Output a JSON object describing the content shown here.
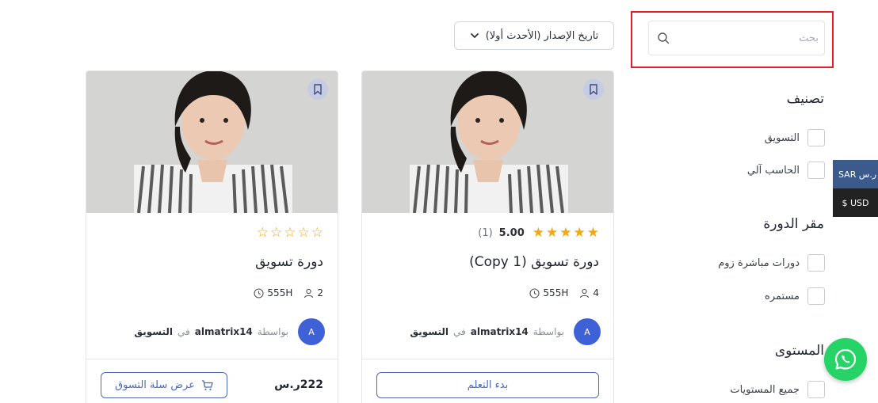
{
  "search": {
    "placeholder": "بحث"
  },
  "sort": {
    "selected": "تاريخ الإصدار (الأحدث أولا)"
  },
  "sidebar": {
    "category": {
      "title": "تصنيف",
      "items": [
        "التسويق",
        "الحاسب آلي"
      ]
    },
    "location": {
      "title": "مقر الدورة",
      "items": [
        "دورات مباشرة زوم",
        "مستمره"
      ]
    },
    "level": {
      "title": "المستوى",
      "items": [
        "جميع المستويات"
      ]
    }
  },
  "currency": {
    "sar": "SAR ر.س",
    "usd": "$ USD"
  },
  "courses": [
    {
      "rating_value": 5,
      "rating": "5.00",
      "rating_count": "(1)",
      "title": "دورة تسويق (Copy 1)",
      "duration": "555H",
      "students": "4",
      "by": "بواسطة",
      "author": "almatrix14",
      "in": "في",
      "category": "التسويق",
      "avatar": "A",
      "action": "بدء التعلم"
    },
    {
      "rating_value": 0,
      "title": "دورة تسويق",
      "duration": "555H",
      "students": "2",
      "by": "بواسطة",
      "author": "almatrix14",
      "in": "في",
      "category": "التسويق",
      "avatar": "A",
      "price": "222ر.س",
      "action": "عرض سلة التسوق"
    }
  ],
  "colors": {
    "accent": "#4a6bb8",
    "star": "#f3a712",
    "highlight": "#e51e25",
    "whatsapp": "#25d366"
  }
}
